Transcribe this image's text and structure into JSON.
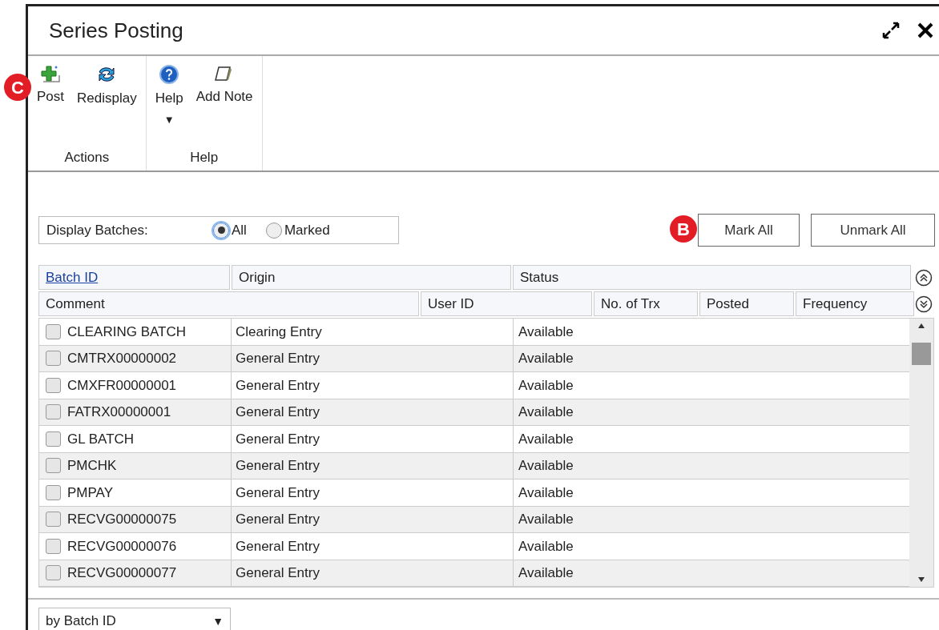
{
  "window": {
    "title": "Series Posting"
  },
  "ribbon": {
    "groups": [
      {
        "label": "Actions",
        "items": [
          {
            "kind": "post",
            "label": "Post"
          },
          {
            "kind": "redisplay",
            "label": "Redisplay"
          }
        ]
      },
      {
        "label": "Help",
        "items": [
          {
            "kind": "help",
            "label": "Help",
            "dropdown": "▼"
          },
          {
            "kind": "note",
            "label": "Add Note"
          }
        ]
      }
    ]
  },
  "callouts": [
    {
      "label": "C"
    },
    {
      "label": "B"
    }
  ],
  "display_batches": {
    "label": "Display Batches:",
    "options": [
      {
        "label": "All",
        "selected": true
      },
      {
        "label": "Marked",
        "selected": false
      }
    ]
  },
  "buttons": [
    "Mark All",
    "Unmark All"
  ],
  "table": {
    "header_row_1": [
      {
        "label": "Batch ID",
        "link": true
      },
      {
        "label": "Origin",
        "link": false
      },
      {
        "label": "Status",
        "link": false
      }
    ],
    "header_row_2": [
      "Comment",
      "User ID",
      "No. of Trx",
      "Posted",
      "Frequency"
    ],
    "rows": [
      {
        "checked": false,
        "batch_id": "CLEARING BATCH",
        "origin": "Clearing Entry",
        "status": "Available"
      },
      {
        "checked": false,
        "batch_id": "CMTRX00000002",
        "origin": "General Entry",
        "status": "Available"
      },
      {
        "checked": false,
        "batch_id": "CMXFR00000001",
        "origin": "General Entry",
        "status": "Available"
      },
      {
        "checked": false,
        "batch_id": "FATRX00000001",
        "origin": "General Entry",
        "status": "Available"
      },
      {
        "checked": false,
        "batch_id": "GL BATCH",
        "origin": "General Entry",
        "status": "Available"
      },
      {
        "checked": false,
        "batch_id": "PMCHK",
        "origin": "General Entry",
        "status": "Available"
      },
      {
        "checked": false,
        "batch_id": "PMPAY",
        "origin": "General Entry",
        "status": "Available"
      },
      {
        "checked": false,
        "batch_id": "RECVG00000075",
        "origin": "General Entry",
        "status": "Available"
      },
      {
        "checked": false,
        "batch_id": "RECVG00000076",
        "origin": "General Entry",
        "status": "Available"
      },
      {
        "checked": false,
        "batch_id": "RECVG00000077",
        "origin": "General Entry",
        "status": "Available"
      }
    ]
  },
  "sort_dropdown": {
    "value": "by Batch ID",
    "arrow": "▼"
  }
}
